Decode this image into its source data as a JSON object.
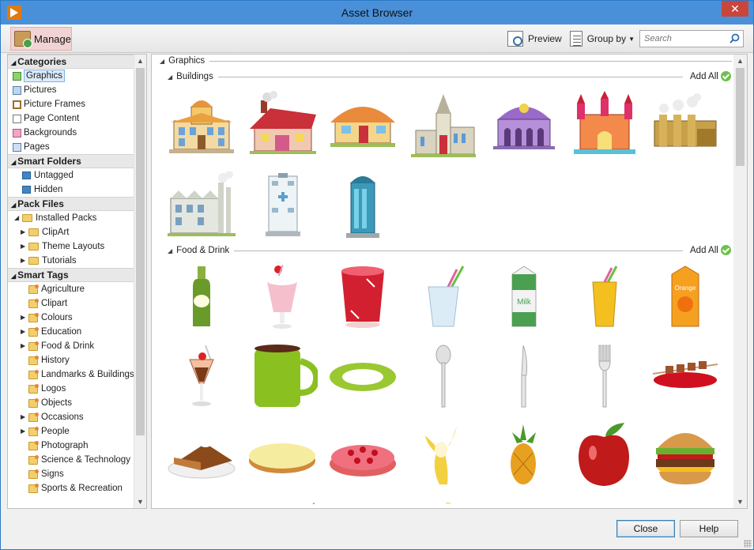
{
  "window": {
    "title": "Asset Browser",
    "close_glyph": "✕"
  },
  "toolbar": {
    "manage_label": "Manage",
    "preview_label": "Preview",
    "groupby_label": "Group by",
    "search_placeholder": "Search"
  },
  "sidebar": {
    "categories": {
      "header": "Categories",
      "items": [
        "Graphics",
        "Pictures",
        "Picture Frames",
        "Page Content",
        "Backgrounds",
        "Pages"
      ]
    },
    "smart_folders": {
      "header": "Smart Folders",
      "items": [
        "Untagged",
        "Hidden"
      ]
    },
    "pack_files": {
      "header": "Pack Files",
      "root": "Installed Packs",
      "items": [
        "ClipArt",
        "Theme Layouts",
        "Tutorials"
      ]
    },
    "smart_tags": {
      "header": "Smart Tags",
      "items": [
        "Agriculture",
        "Clipart",
        "Colours",
        "Education",
        "Food & Drink",
        "History",
        "Landmarks & Buildings",
        "Logos",
        "Objects",
        "Occasions",
        "People",
        "Photograph",
        "Science & Technology",
        "Signs",
        "Sports & Recreation"
      ]
    }
  },
  "content": {
    "root_group": "Graphics",
    "groups": [
      {
        "name": "Buildings",
        "add_all": "Add All",
        "item_count": 10
      },
      {
        "name": "Food & Drink",
        "add_all": "Add All",
        "item_count": 21
      }
    ]
  },
  "footer": {
    "close_label": "Close",
    "help_label": "Help"
  },
  "colors": {
    "titlebar": "#4a90d9",
    "selection": "#dbeafb",
    "close_button": "#c9463d",
    "add_all_check": "#6cc24a"
  }
}
